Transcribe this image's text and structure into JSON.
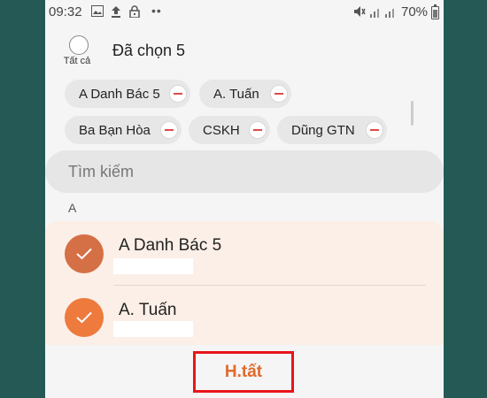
{
  "status_bar": {
    "time": "09:32",
    "icons_left": [
      "image-icon",
      "upload-icon",
      "lock-icon",
      "more-icon"
    ],
    "icons_right": [
      "mute-icon",
      "signal-icon",
      "signal-icon"
    ],
    "battery_percent": "70%"
  },
  "header": {
    "select_all_label": "Tất cả",
    "selected_count_label": "Đã chọn 5"
  },
  "chips": [
    {
      "label": "A Danh Bác 5"
    },
    {
      "label": "A. Tuấn"
    },
    {
      "label": "Ba Bạn Hòa"
    },
    {
      "label": "CSKH"
    },
    {
      "label": "Dũng GTN"
    }
  ],
  "search": {
    "placeholder": "Tìm kiếm"
  },
  "section": {
    "letter": "A"
  },
  "contacts": [
    {
      "name": "A Danh Bác 5",
      "checked": true,
      "avatar_color": "#d56f45"
    },
    {
      "name": "A. Tuấn",
      "checked": true,
      "avatar_color": "#ee7a3e"
    }
  ],
  "footer": {
    "done_label": "H.tất"
  },
  "colors": {
    "accent": "#e06a2c",
    "highlight_border": "#e8151b",
    "background": "#245955",
    "minus": "#e04a4a"
  }
}
